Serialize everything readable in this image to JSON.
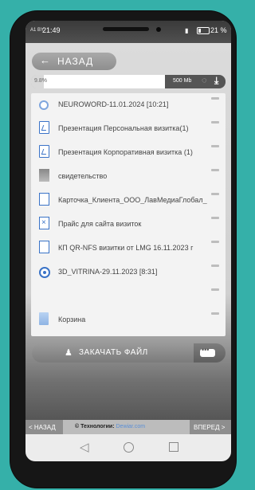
{
  "status_bar": {
    "carrier": "A1 BY",
    "time": "21:49",
    "battery": "21 %"
  },
  "header": {
    "back_label": "НАЗАД"
  },
  "storage": {
    "percent_label": "9.8%",
    "fill_fraction": 0.098,
    "capacity": "500 Mb"
  },
  "files": [
    {
      "name": "NEUROWORD-11.01.2024 [10:21]",
      "icon": "gear-icon"
    },
    {
      "name": "Презентация Персональная визитка(1)",
      "icon": "document-icon"
    },
    {
      "name": "Презентация Корпоративная визитка (1)",
      "icon": "document-icon"
    },
    {
      "name": "свидетельство",
      "icon": "image-icon"
    },
    {
      "name": "Карточка_Клиента_ООО_ЛавМедиаГлобал_",
      "icon": "page-icon"
    },
    {
      "name": "Прайс для сайта визиток",
      "icon": "spreadsheet-icon"
    },
    {
      "name": "КП QR-NFS визитки от LMG 16.11.2023 г",
      "icon": "page-icon"
    },
    {
      "name": "3D_VITRINA-29.11.2023 [8:31]",
      "icon": "3d-icon"
    },
    {
      "name": "",
      "icon": ""
    },
    {
      "name": "Корзина",
      "icon": "trash-icon"
    }
  ],
  "actions": {
    "upload_label": "ЗАКАЧАТЬ ФАЙЛ"
  },
  "footer": {
    "prev_label": "< НАЗАД",
    "next_label": "ВПЕРЕД >",
    "credit_prefix": "© Технологии:",
    "credit_brand": "Dewiar.com"
  }
}
